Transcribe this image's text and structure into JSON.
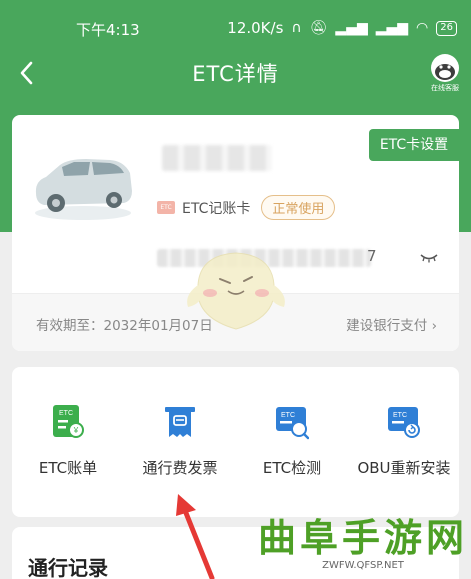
{
  "status_bar": {
    "time": "下午4:13",
    "network_speed": "12.0K/s",
    "battery": "26"
  },
  "nav": {
    "title": "ETC详情",
    "service_label": "在线客服"
  },
  "card": {
    "settings_label": "ETC卡设置",
    "card_type": "ETC记账卡",
    "etc_mini_text": "ETC",
    "status": "正常使用",
    "card_number_tail": "7",
    "validity": "有效期至：2032年01月07日",
    "bank": "建设银行支付 ›"
  },
  "tools": [
    {
      "label": "ETC账单",
      "icon": "etc-bill-icon"
    },
    {
      "label": "通行费发票",
      "icon": "invoice-icon"
    },
    {
      "label": "ETC检测",
      "icon": "etc-check-icon"
    },
    {
      "label": "OBU重新安装",
      "icon": "obu-reinstall-icon"
    }
  ],
  "records": {
    "title": "通行记录"
  },
  "watermark": {
    "main": "曲阜手游网",
    "sub": "ZWFW.QFSP.NET"
  },
  "colors": {
    "brand_green": "#49a75c",
    "icon_blue": "#2f7fd6",
    "icon_green": "#3cae4c",
    "badge_orange": "#d8a35f"
  }
}
